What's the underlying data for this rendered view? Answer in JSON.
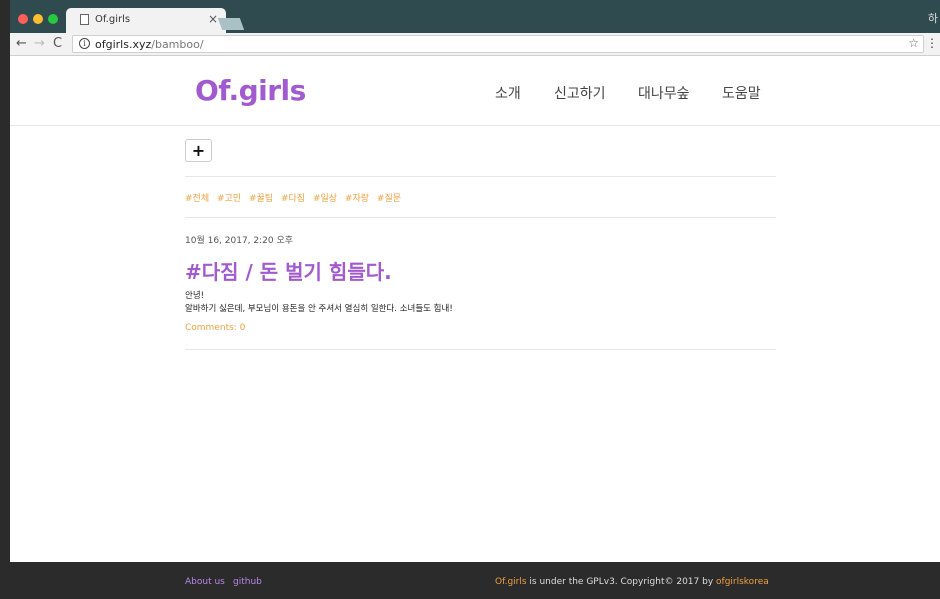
{
  "browser": {
    "tab_title": "Of.girls",
    "tab_close": "×",
    "corner_glyph": "하",
    "url_host": "ofgirls.xyz",
    "url_path": "/bamboo/",
    "back": "←",
    "forward": "→",
    "reload": "C",
    "info": "i",
    "star": "☆",
    "menu": "⋮"
  },
  "header": {
    "logo": "Of.girls",
    "nav": [
      "소개",
      "신고하기",
      "대나무숲",
      "도움말"
    ]
  },
  "main": {
    "add_button": "+",
    "tags": [
      "#전체",
      "#고민",
      "#꿀팁",
      "#다짐",
      "#일상",
      "#자랑",
      "#질문"
    ],
    "post": {
      "date": "10월 16, 2017, 2:20 오후",
      "title": "#다짐 / 돈 벌기 힘들다.",
      "body_line1": "안녕!",
      "body_line2": "알바하기 싫은데, 부모님이 용돈을 안 주셔서 열심히 일한다. 소녀들도 힘내!",
      "comments": "Comments: 0"
    }
  },
  "footer": {
    "about": "About us",
    "github": "github",
    "brand": "Of.girls",
    "license_text": " is under the GPLv3. Copyright© 2017 by ",
    "author": "ofgirlskorea"
  },
  "colors": {
    "accent_purple": "#a25ad0",
    "accent_orange": "#f0a040",
    "footer_bg": "#2b2b2b"
  }
}
